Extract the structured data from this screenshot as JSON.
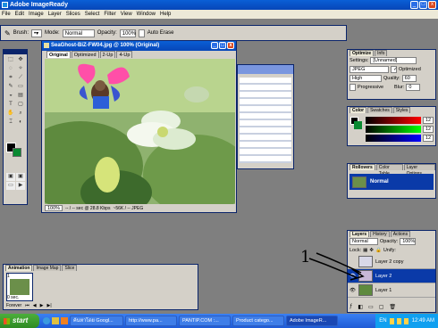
{
  "app": {
    "title": "Adobe ImageReady"
  },
  "window_buttons": {
    "minimize": "_",
    "maximize": "□",
    "close": "x"
  },
  "menu": [
    "File",
    "Edit",
    "Image",
    "Layer",
    "Slices",
    "Select",
    "Filter",
    "View",
    "Window",
    "Help"
  ],
  "options": {
    "brush_label": "Brush:",
    "mode_label": "Mode:",
    "mode_value": "Normal",
    "opacity_label": "Opacity:",
    "opacity_value": "100%",
    "auto_erase": "Auto Erase"
  },
  "document": {
    "title": "SeaGhost-BiZ-FW04.jpg @ 100% (Original)",
    "tabs": [
      "Original",
      "Optimized",
      "2-Up",
      "4-Up"
    ],
    "zoom": "100%",
    "status_a": "-- / -- sec @ 28.8 Kbps",
    "status_b": "~56K / -- JPEG"
  },
  "optimize": {
    "tabs": [
      "Optimize",
      "Info"
    ],
    "settings_label": "Settings:",
    "settings_value": "[Unnamed]",
    "format": "JPEG",
    "optimized_label": "Optimized",
    "quality_level": "High",
    "quality_label": "Quality:",
    "quality_value": "60",
    "progressive_label": "Progressive",
    "blur_label": "Blur:",
    "blur_value": "0"
  },
  "color": {
    "tabs": [
      "Color",
      "Swatches",
      "Styles"
    ],
    "channel_values": [
      "12",
      "12",
      "12"
    ]
  },
  "rollovers": {
    "tabs": [
      "Rollovers",
      "Color Table",
      "Layer Options"
    ],
    "state_label": "Normal"
  },
  "layers": {
    "tabs": [
      "Layers",
      "History",
      "Actions"
    ],
    "blend_mode": "Normal",
    "opacity_label": "Opacity:",
    "opacity_value": "100%",
    "lock_label": "Lock:",
    "unify_label": "Unify:",
    "items": [
      {
        "name": "Layer 2 copy",
        "selected": false
      },
      {
        "name": "Layer 2",
        "selected": true
      },
      {
        "name": "Layer 1",
        "selected": false
      }
    ]
  },
  "animation": {
    "tabs": [
      "Animation",
      "Image Map",
      "Slice"
    ],
    "frame_number": "1",
    "frame_delay": "0 sec.",
    "loop": "Forever"
  },
  "annotation": {
    "text": "1"
  },
  "taskbar": {
    "start_label": "start",
    "tasks": [
      "ค้นหาโดย Googl...",
      "http://www.pa...",
      "PANTIP.COM :...",
      "Product catego...",
      "Adobe ImageR..."
    ],
    "language": "EN",
    "clock": "12:49 AM"
  }
}
